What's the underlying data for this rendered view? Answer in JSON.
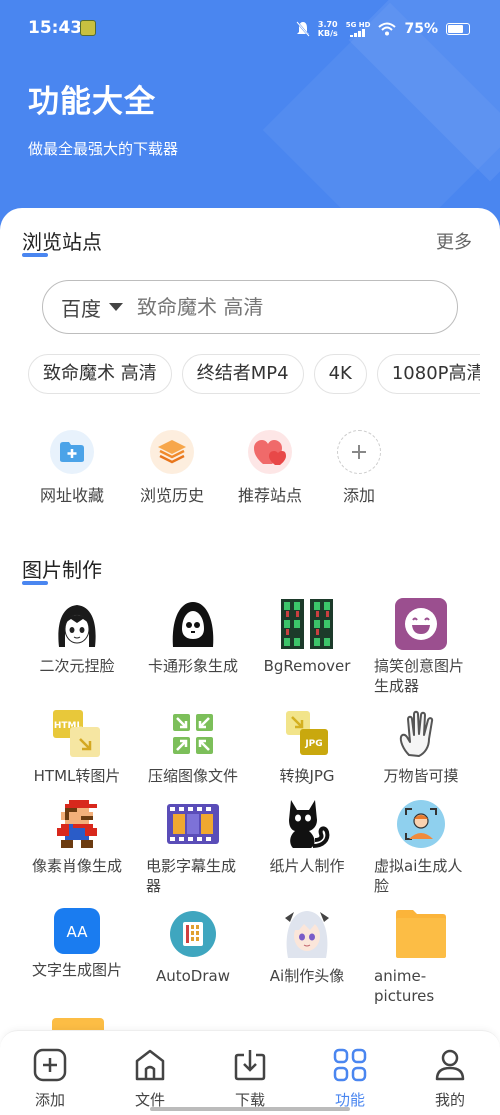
{
  "status_bar": {
    "time": "15:43",
    "net_speed_value": "3.70",
    "net_speed_unit": "KB/s",
    "network": "5G HD",
    "battery": "75%"
  },
  "header": {
    "title": "功能大全",
    "subtitle": "做最全最强大的下载器"
  },
  "browse": {
    "title": "浏览站点",
    "more": "更多",
    "search": {
      "engine": "百度",
      "placeholder": "致命魔术 高清"
    },
    "chips": [
      "致命魔术 高清",
      "终结者MP4",
      "4K",
      "1080P高清"
    ],
    "quick": [
      {
        "label": "网址收藏",
        "icon": "bookmark-folder-icon"
      },
      {
        "label": "浏览历史",
        "icon": "history-layers-icon"
      },
      {
        "label": "推荐站点",
        "icon": "heart-icon"
      },
      {
        "label": "添加",
        "icon": "plus-icon"
      }
    ]
  },
  "image_tools": {
    "title": "图片制作",
    "items": [
      {
        "label": "二次元捏脸",
        "icon": "anime-face-icon"
      },
      {
        "label": "卡通形象生成",
        "icon": "cartoon-ghost-icon"
      },
      {
        "label": "BgRemover",
        "icon": "bg-remover-icon"
      },
      {
        "label": "搞笑创意图片生成器",
        "icon": "smiley-icon"
      },
      {
        "label": "HTML转图片",
        "icon": "html-convert-icon"
      },
      {
        "label": "压缩图像文件",
        "icon": "compress-icon"
      },
      {
        "label": "转换JPG",
        "icon": "jpg-convert-icon"
      },
      {
        "label": "万物皆可摸",
        "icon": "hand-icon"
      },
      {
        "label": "像素肖像生成",
        "icon": "pixel-mario-icon"
      },
      {
        "label": "电影字幕生成器",
        "icon": "film-strip-icon"
      },
      {
        "label": "纸片人制作",
        "icon": "black-cat-icon"
      },
      {
        "label": "虚拟ai生成人脸",
        "icon": "face-scan-icon"
      },
      {
        "label": "文字生成图片",
        "icon": "text-aa-icon"
      },
      {
        "label": "AutoDraw",
        "icon": "autodraw-icon"
      },
      {
        "label": "Ai制作头像",
        "icon": "anime-avatar-icon"
      },
      {
        "label": "anime-pictures",
        "icon": "folder-icon"
      }
    ]
  },
  "bottom_nav": [
    {
      "label": "添加",
      "icon": "add-square-icon"
    },
    {
      "label": "文件",
      "icon": "house-icon"
    },
    {
      "label": "下载",
      "icon": "download-icon"
    },
    {
      "label": "功能",
      "icon": "grid-icon"
    },
    {
      "label": "我的",
      "icon": "profile-icon"
    }
  ],
  "colors": {
    "accent": "#4a86f0",
    "header_bg": "#4a86f0"
  }
}
